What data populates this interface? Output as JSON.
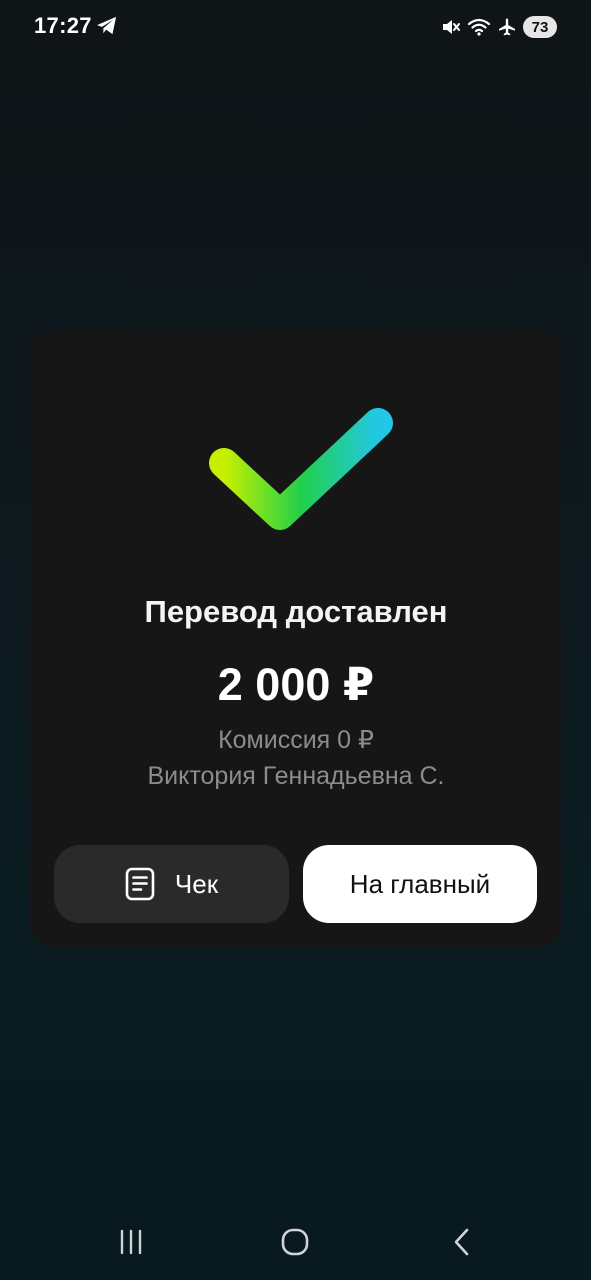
{
  "status_bar": {
    "time": "17:27",
    "battery": "73",
    "icons": [
      "telegram-icon",
      "mute-icon",
      "wifi-icon",
      "airplane-icon"
    ]
  },
  "result": {
    "title": "Перевод доставлен",
    "amount": "2 000 ₽",
    "commission": "Комиссия 0 ₽",
    "recipient": "Виктория Геннадьевна С."
  },
  "buttons": {
    "receipt_label": "Чек",
    "home_label": "На главный"
  },
  "navigation": {
    "items": [
      "recents",
      "home",
      "back"
    ]
  },
  "colors": {
    "card": "#161616",
    "check_gradient": [
      "#c7f000",
      "#21d04a",
      "#22c7e6"
    ],
    "home_button": "#ffffff",
    "receipt_button": "#2a2a2a",
    "secondary_text": "#8c8c8c"
  }
}
